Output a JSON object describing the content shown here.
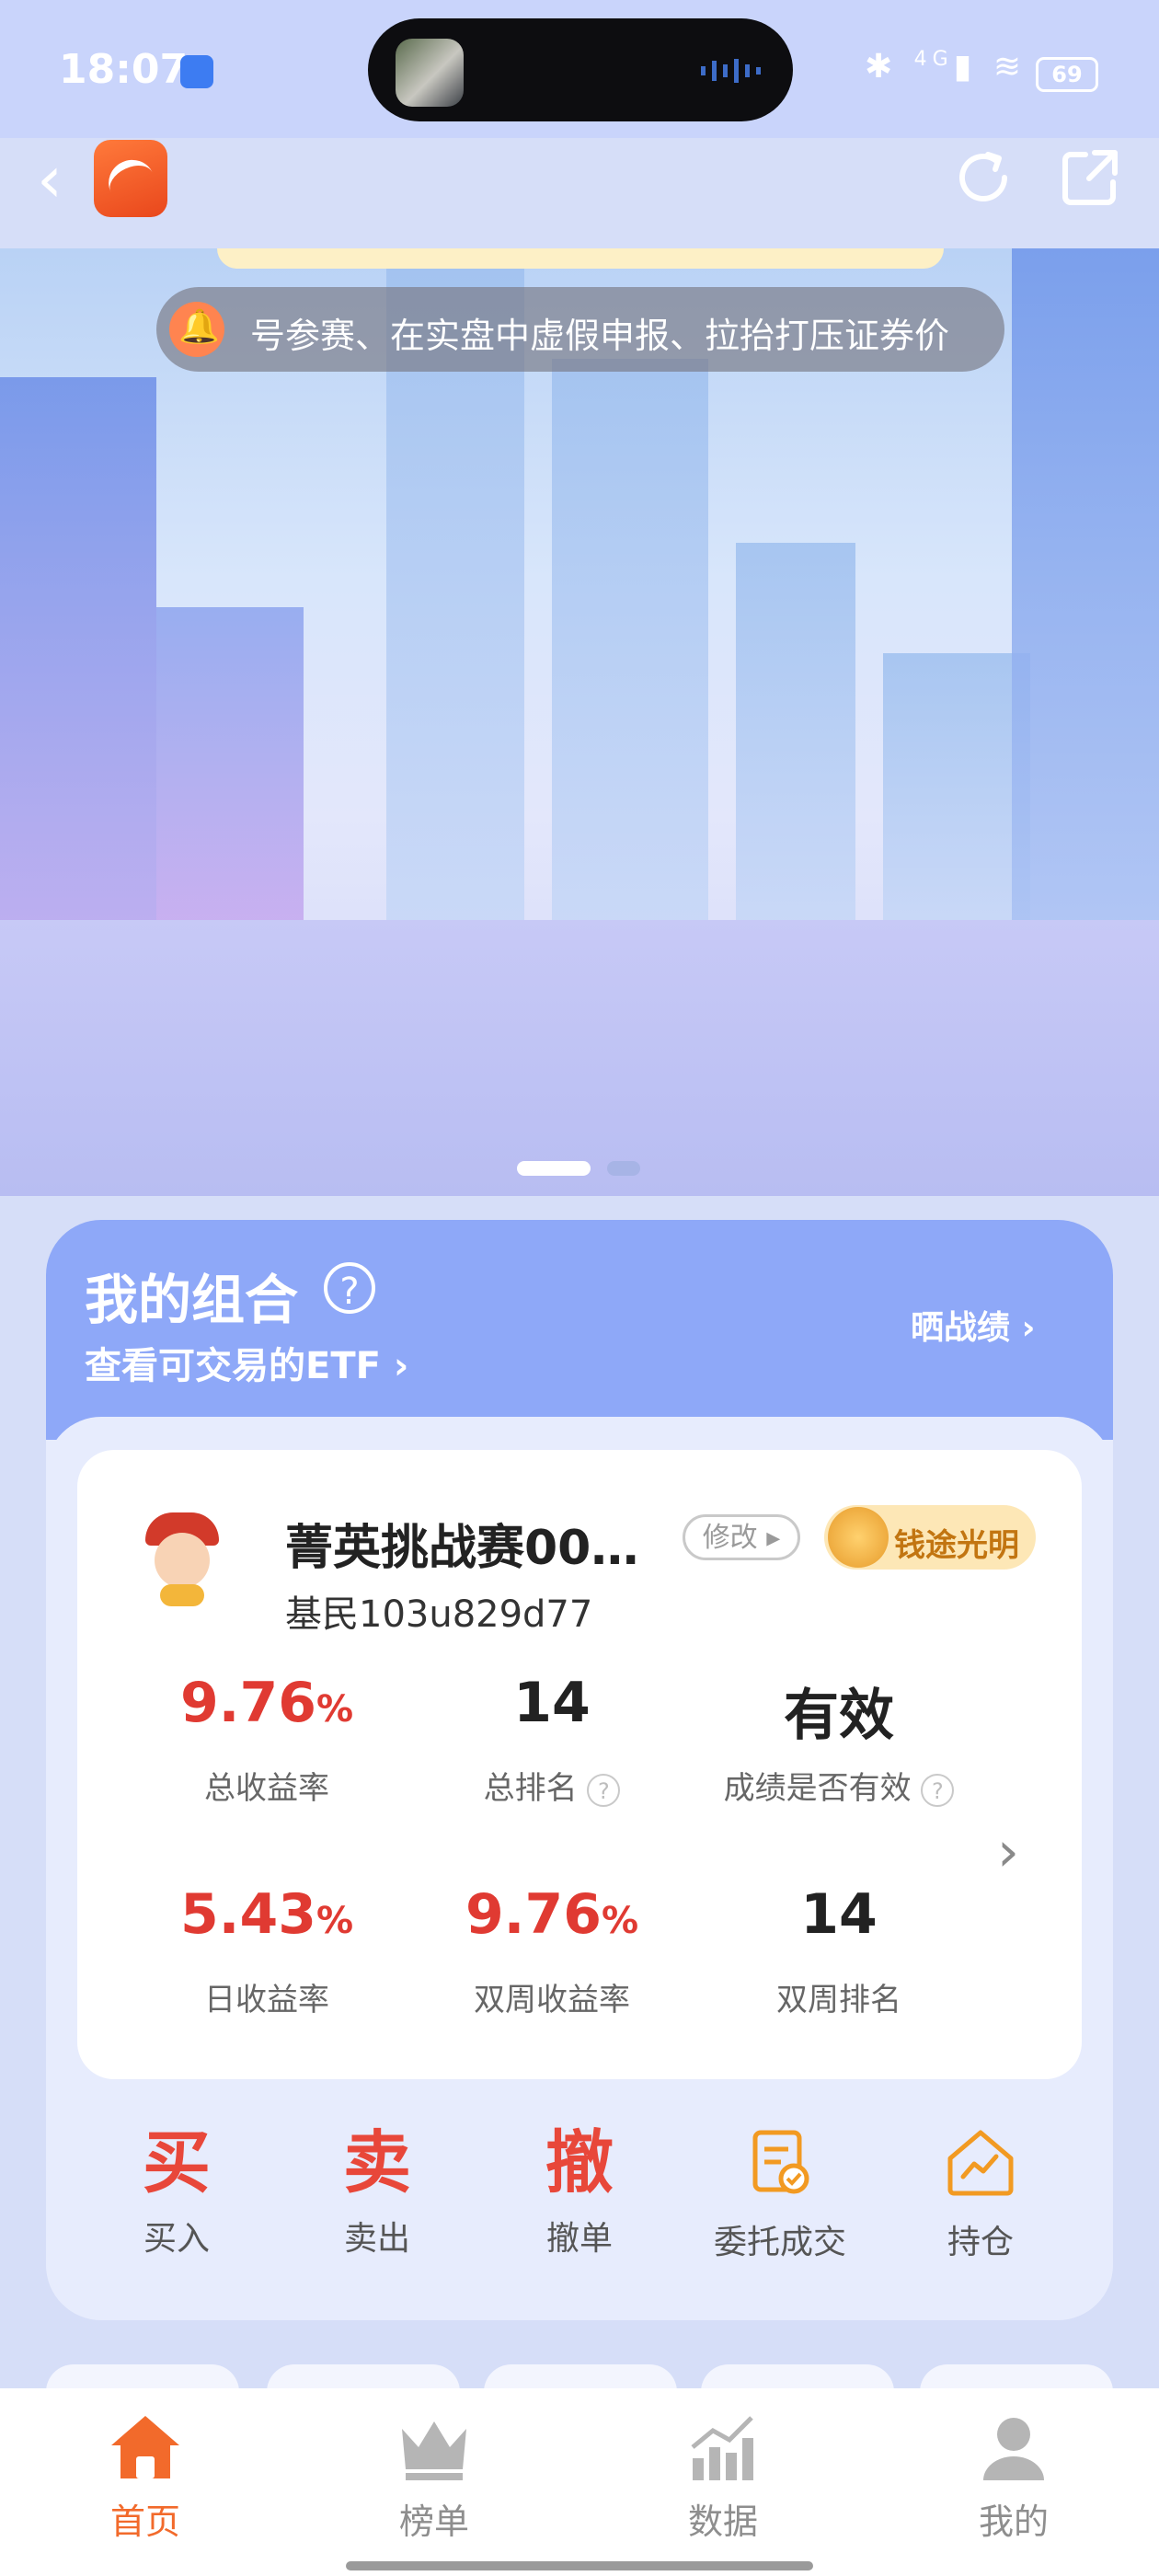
{
  "status_bar": {
    "time": "18:07",
    "battery": "69",
    "signal": "4G"
  },
  "notice": {
    "text": "号参赛、在实盘中虚假申报、拉抬打压证券价"
  },
  "portfolio": {
    "title": "我的组合",
    "help": "?",
    "etf_link": "查看可交易的ETF",
    "show_results": "晒战绩",
    "name": "菁英挑战赛00…",
    "edit_label": "修改",
    "medal_label": "钱途光明",
    "user": "基民103u829d77",
    "stats": {
      "total_return": {
        "value": "9.76",
        "unit": "%",
        "label": "总收益率"
      },
      "total_rank": {
        "value": "14",
        "label": "总排名"
      },
      "validity": {
        "value": "有效",
        "label": "成绩是否有效"
      },
      "daily_return": {
        "value": "5.43",
        "unit": "%",
        "label": "日收益率"
      },
      "biweekly_return": {
        "value": "9.76",
        "unit": "%",
        "label": "双周收益率"
      },
      "biweekly_rank": {
        "value": "14",
        "label": "双周排名"
      }
    },
    "actions": [
      {
        "icon_char": "买",
        "label": "买入",
        "color": "#e8473a"
      },
      {
        "icon_char": "卖",
        "label": "卖出",
        "color": "#e8473a"
      },
      {
        "icon_char": "撤",
        "label": "撤单",
        "color": "#e8473a"
      },
      {
        "icon": "order-deal-icon",
        "label": "委托成交",
        "color": "#f29a22"
      },
      {
        "icon": "holdings-icon",
        "label": "持仓",
        "color": "#f29a22"
      }
    ]
  },
  "tabbar": {
    "items": [
      {
        "label": "首页",
        "icon": "home-icon",
        "active": true
      },
      {
        "label": "榜单",
        "icon": "crown-icon",
        "active": false
      },
      {
        "label": "数据",
        "icon": "chart-icon",
        "active": false
      },
      {
        "label": "我的",
        "icon": "user-icon",
        "active": false
      }
    ],
    "active_color": "#f26a2b",
    "inactive_color": "#8e8e8e"
  }
}
